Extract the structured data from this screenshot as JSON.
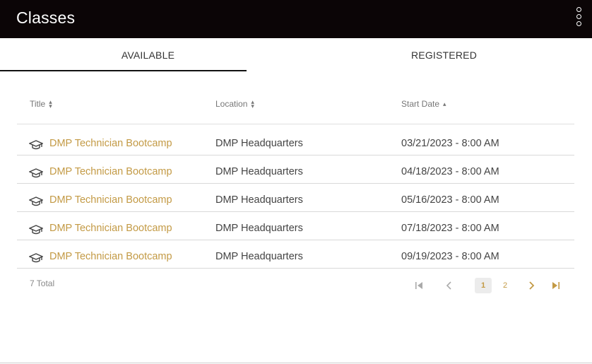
{
  "appbar": {
    "title": "Classes",
    "menu_icon": "more-vertical-icon"
  },
  "tabs": [
    {
      "label": "AVAILABLE",
      "active": true
    },
    {
      "label": "REGISTERED",
      "active": false
    }
  ],
  "table": {
    "columns": [
      {
        "label": "Title",
        "sort": "none"
      },
      {
        "label": "Location",
        "sort": "none"
      },
      {
        "label": "Start Date",
        "sort": "ascending"
      }
    ],
    "rows": [
      {
        "title": "DMP Technician Bootcamp",
        "location": "DMP Headquarters",
        "start": "03/21/2023 - 8:00 AM"
      },
      {
        "title": "DMP Technician Bootcamp",
        "location": "DMP Headquarters",
        "start": "04/18/2023 - 8:00 AM"
      },
      {
        "title": "DMP Technician Bootcamp",
        "location": "DMP Headquarters",
        "start": "05/16/2023 - 8:00 AM"
      },
      {
        "title": "DMP Technician Bootcamp",
        "location": "DMP Headquarters",
        "start": "07/18/2023 - 8:00 AM"
      },
      {
        "title": "DMP Technician Bootcamp",
        "location": "DMP Headquarters",
        "start": "09/19/2023 - 8:00 AM"
      }
    ],
    "row_icon": "graduation-cap-icon"
  },
  "footer": {
    "total": "7 Total",
    "pagination": {
      "pages": [
        "1",
        "2"
      ],
      "current": "1"
    }
  },
  "colors": {
    "appbar_bg": "#0b0506",
    "link": "#c39a45",
    "tab_indicator": "#111111"
  }
}
